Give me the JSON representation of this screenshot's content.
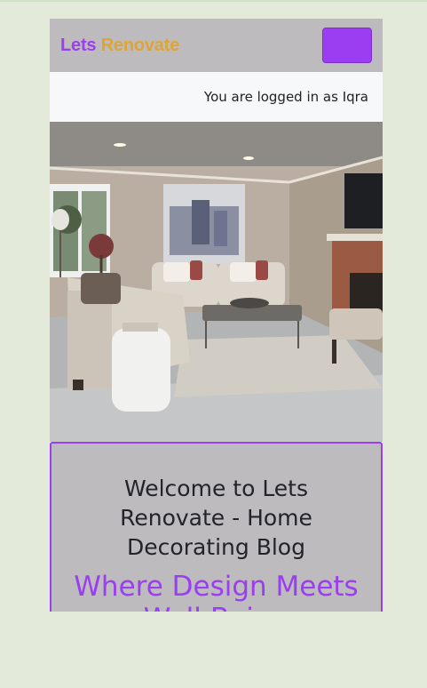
{
  "brand": {
    "word1": "Lets",
    "word2": "Renovate"
  },
  "colors": {
    "purple": "#9b3df0",
    "gold": "#dfa534",
    "navbar_bg": "#bdbbbd"
  },
  "navbar": {
    "toggler_icon": "menu-toggle"
  },
  "userbar": {
    "text": "You are logged in as Iqra"
  },
  "hero": {
    "image_subject": "living-room-interior"
  },
  "welcome": {
    "title": "Welcome to Lets Renovate - Home Decorating Blog",
    "tagline": "Where Design Meets Well-Being"
  }
}
